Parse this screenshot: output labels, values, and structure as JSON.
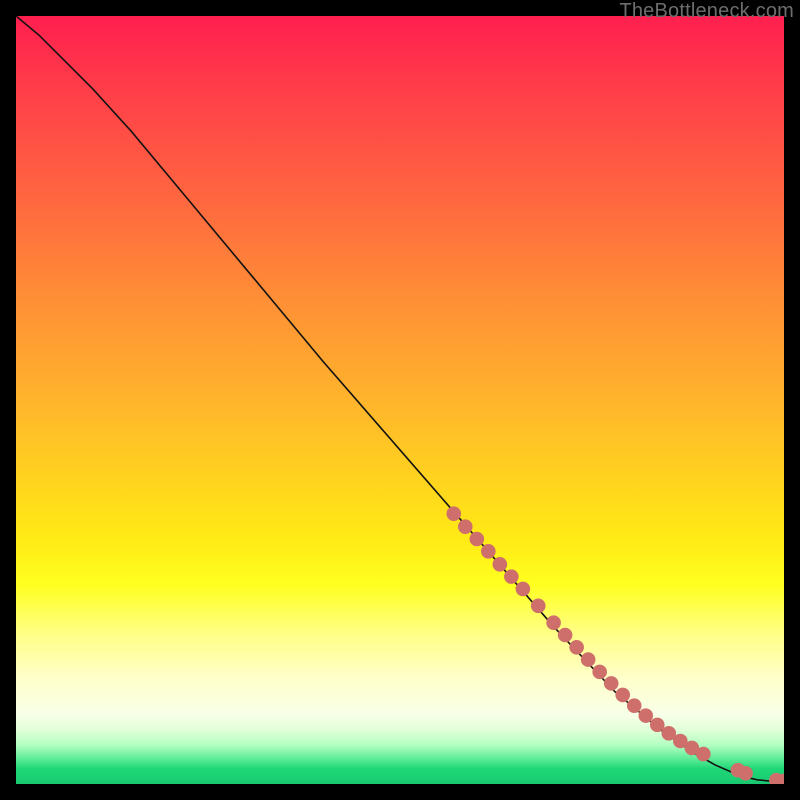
{
  "watermark": "TheBottleneck.com",
  "chart_data": {
    "type": "line",
    "title": "",
    "xlabel": "",
    "ylabel": "",
    "xlim": [
      0,
      100
    ],
    "ylim": [
      0,
      100
    ],
    "grid": false,
    "series": [
      {
        "name": "curve",
        "color": "#131313",
        "x": [
          0,
          3,
          6,
          10,
          15,
          20,
          30,
          40,
          50,
          60,
          70,
          78,
          84,
          88,
          91,
          93.5,
          95,
          96.5,
          98,
          100
        ],
        "y": [
          100,
          97.5,
          94.5,
          90.5,
          85,
          79,
          67,
          55,
          43.5,
          32,
          20.5,
          12,
          7,
          4.2,
          2.5,
          1.4,
          0.9,
          0.55,
          0.4,
          0.4
        ]
      },
      {
        "name": "markers",
        "color": "#cf6f6c",
        "type": "scatter",
        "x": [
          57,
          58.5,
          60,
          61.5,
          63,
          64.5,
          66,
          68,
          70,
          71.5,
          73,
          74.5,
          76,
          77.5,
          79,
          80.5,
          82,
          83.5,
          85,
          86.5,
          88,
          89.5,
          94,
          95,
          99,
          100
        ],
        "y": [
          35.2,
          33.5,
          31.9,
          30.3,
          28.6,
          27,
          25.4,
          23.2,
          21,
          19.4,
          17.8,
          16.2,
          14.6,
          13.1,
          11.6,
          10.2,
          8.9,
          7.7,
          6.6,
          5.6,
          4.7,
          3.9,
          1.8,
          1.4,
          0.5,
          0.4
        ]
      }
    ],
    "background": {
      "type": "vertical-gradient",
      "stops": [
        {
          "pos": 0.0,
          "color": "#ff1f4f"
        },
        {
          "pos": 0.5,
          "color": "#ffd21f"
        },
        {
          "pos": 0.74,
          "color": "#ffff20"
        },
        {
          "pos": 0.91,
          "color": "#f8ffe8"
        },
        {
          "pos": 1.0,
          "color": "#18c870"
        }
      ]
    }
  }
}
